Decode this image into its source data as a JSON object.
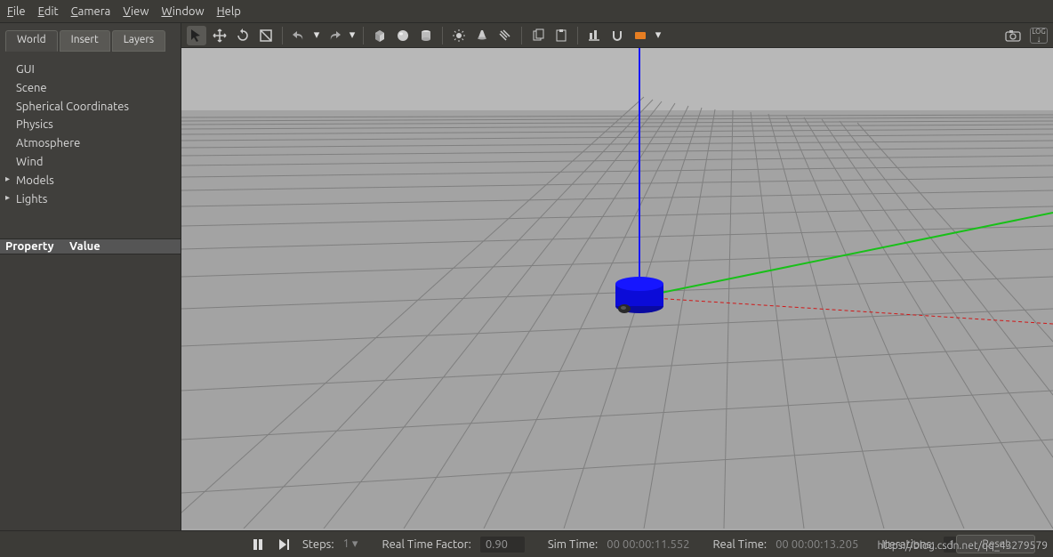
{
  "menu": {
    "file": "File",
    "edit": "Edit",
    "camera": "Camera",
    "view": "View",
    "window": "Window",
    "help": "Help"
  },
  "tabs": {
    "world": "World",
    "insert": "Insert",
    "layers": "Layers"
  },
  "tree": {
    "items": [
      "GUI",
      "Scene",
      "Spherical Coordinates",
      "Physics",
      "Atmosphere",
      "Wind",
      "Models",
      "Lights"
    ],
    "caret": [
      false,
      false,
      false,
      false,
      false,
      false,
      true,
      true
    ]
  },
  "propheader": {
    "property": "Property",
    "value": "Value"
  },
  "toolbar": {
    "tools": [
      "select",
      "translate",
      "rotate",
      "scale",
      "undo",
      "undo-menu",
      "redo",
      "redo-menu",
      "sep",
      "box",
      "sphere",
      "cylinder",
      "sep",
      "sun",
      "spotlight",
      "directional",
      "sep",
      "copy",
      "paste",
      "sep",
      "align",
      "snap",
      "link",
      "link-menu"
    ],
    "right": [
      "screenshot",
      "log"
    ]
  },
  "status": {
    "steps_label": "Steps:",
    "steps_val": "1",
    "rtf_label": "Real Time Factor:",
    "rtf_val": "0.90",
    "sim_label": "Sim Time:",
    "sim_val": "00 00:00:11.552",
    "real_label": "Real Time:",
    "real_val": "00 00:00:13.205",
    "iter_label": "Iterations:",
    "iter_val": "11552",
    "reset": "Reset"
  },
  "watermark": "https://blog.csdn.net/qq_43279579"
}
